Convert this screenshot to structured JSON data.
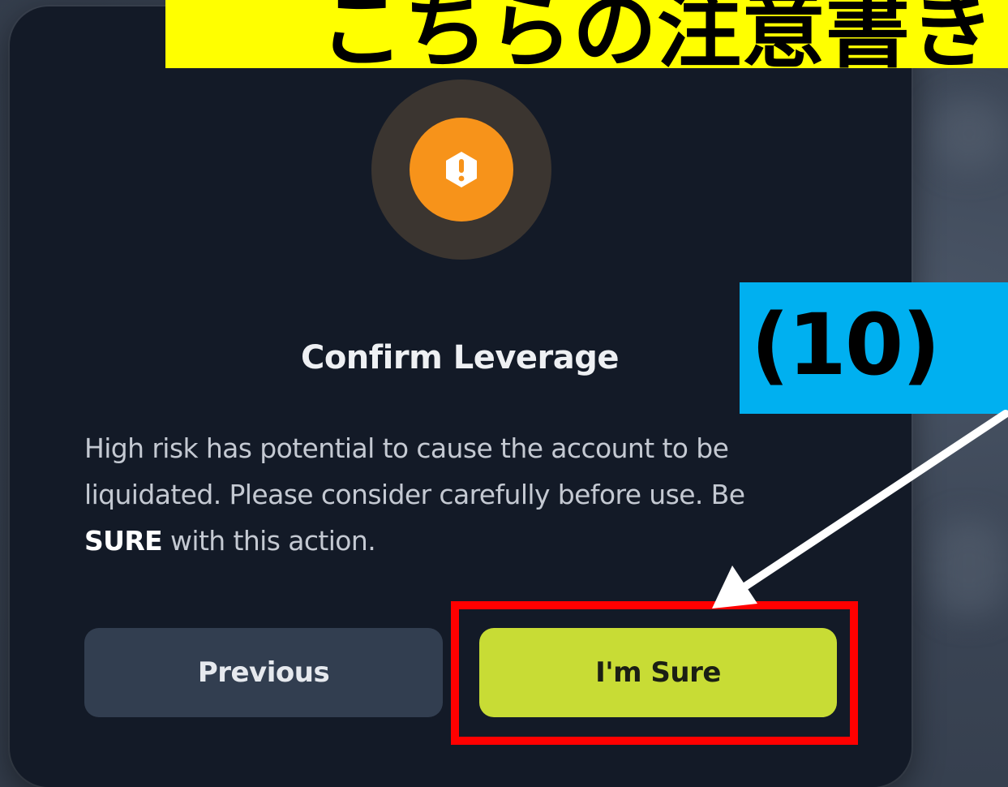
{
  "modal": {
    "title": "Confirm Leverage",
    "body_pre": "High risk has potential to cause the account to be liquidated. Please consider carefully before use. Be ",
    "body_emphasis": "SURE",
    "body_post": " with this action.",
    "icon": "warning-icon",
    "colors": {
      "background": "#131a27",
      "icon_ring": "#3b3530",
      "icon_core": "#f7931a"
    }
  },
  "buttons": {
    "previous_label": "Previous",
    "confirm_label": "I'm Sure",
    "colors": {
      "previous": "#323e50",
      "confirm": "#c8dc35"
    }
  },
  "annotations": {
    "top_banner_text": "こちらの注意書き",
    "step_label_text": "(10)",
    "colors": {
      "top_banner": "#ffff00",
      "step_label": "#00b0f0",
      "highlight": "#ff0000",
      "arrow": "#ffffff"
    }
  }
}
